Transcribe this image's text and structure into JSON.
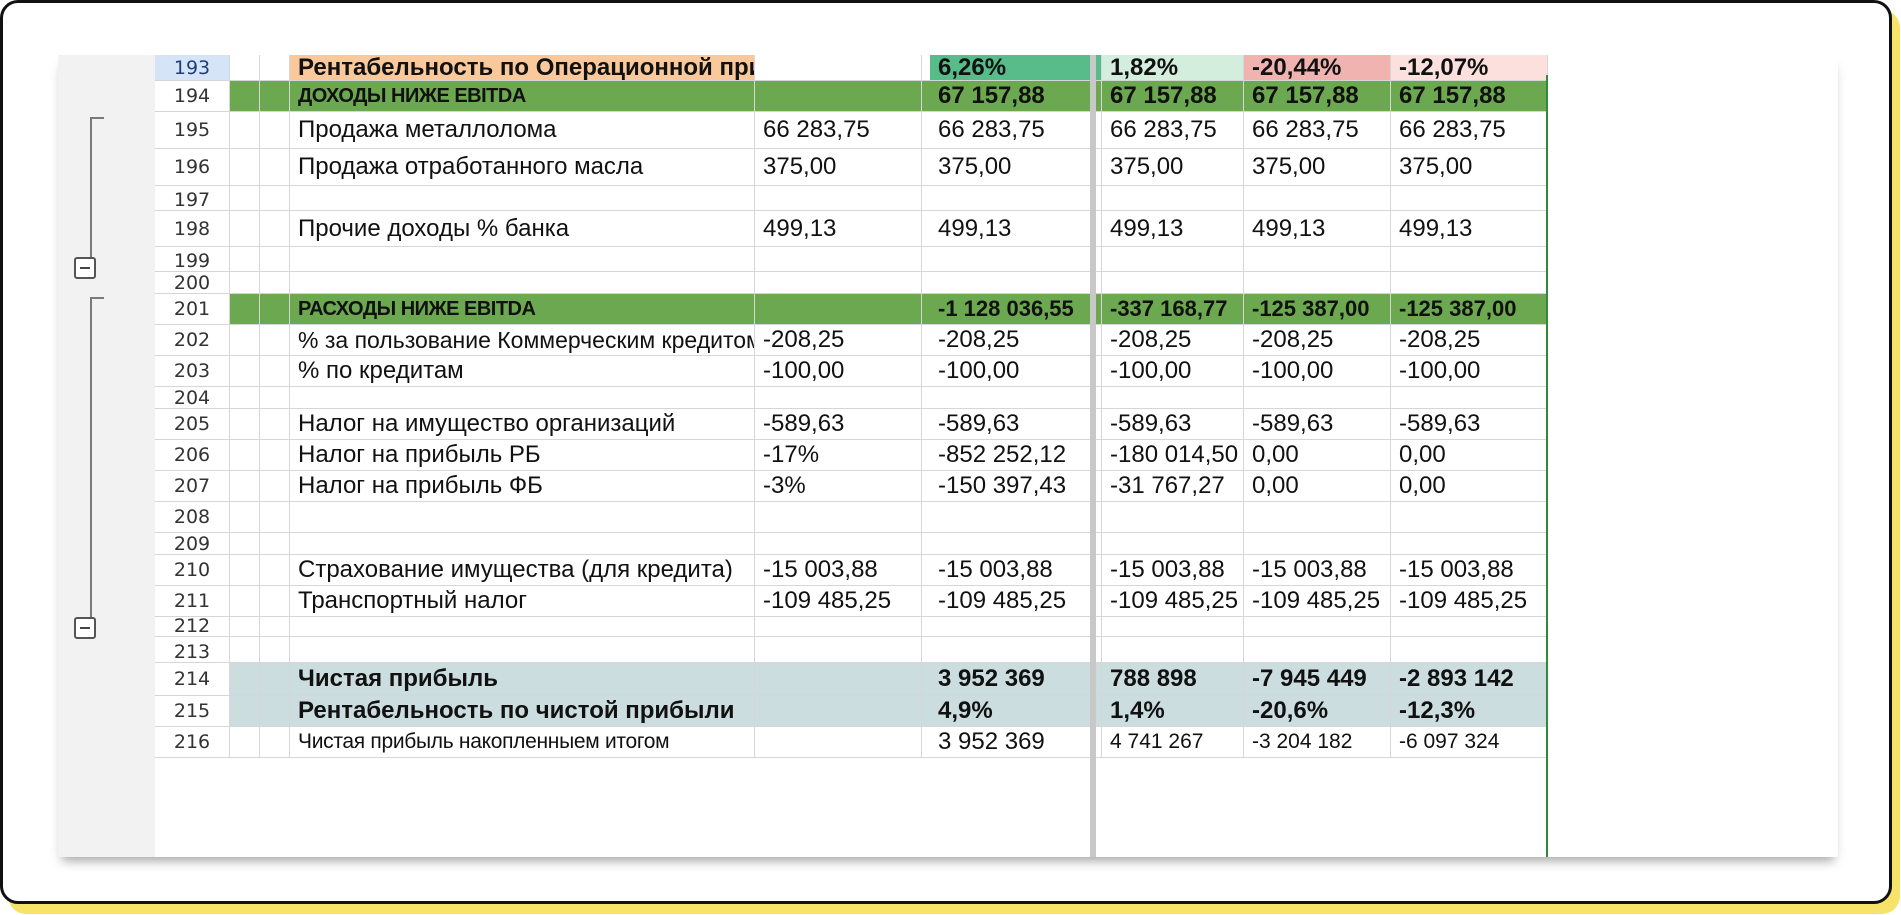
{
  "rows": [
    {
      "num": "193",
      "label": "Рентабельность по Операционной прибыли",
      "base": "",
      "v": [
        "6,26%",
        "1,82%",
        "-20,44%",
        "-12,07%"
      ]
    },
    {
      "num": "194",
      "label": "ДОХОДЫ НИЖЕ EBITDA",
      "base": "",
      "v": [
        "67 157,88",
        "67 157,88",
        "67 157,88",
        "67 157,88"
      ]
    },
    {
      "num": "195",
      "label": "Продажа металлолома",
      "base": "66 283,75",
      "v": [
        "66 283,75",
        "66 283,75",
        "66 283,75",
        "66 283,75"
      ]
    },
    {
      "num": "196",
      "label": "Продажа отработанного масла",
      "base": "375,00",
      "v": [
        "375,00",
        "375,00",
        "375,00",
        "375,00"
      ]
    },
    {
      "num": "197",
      "label": "",
      "base": "",
      "v": [
        "",
        "",
        "",
        ""
      ]
    },
    {
      "num": "198",
      "label": "Прочие доходы % банка",
      "base": "499,13",
      "v": [
        "499,13",
        "499,13",
        "499,13",
        "499,13"
      ]
    },
    {
      "num": "199",
      "label": "",
      "base": "",
      "v": [
        "",
        "",
        "",
        ""
      ]
    },
    {
      "num": "200",
      "label": "",
      "base": "",
      "v": [
        "",
        "",
        "",
        ""
      ]
    },
    {
      "num": "201",
      "label": "РАСХОДЫ НИЖЕ EBITDA",
      "base": "",
      "v": [
        "-1 128 036,55",
        "-337 168,77",
        "-125 387,00",
        "-125 387,00"
      ]
    },
    {
      "num": "202",
      "label": "% за пользование Коммерческим кредитом",
      "base": "-208,25",
      "v": [
        "-208,25",
        "-208,25",
        "-208,25",
        "-208,25"
      ]
    },
    {
      "num": "203",
      "label": "% по кредитам",
      "base": "-100,00",
      "v": [
        "-100,00",
        "-100,00",
        "-100,00",
        "-100,00"
      ]
    },
    {
      "num": "204",
      "label": "",
      "base": "",
      "v": [
        "",
        "",
        "",
        ""
      ]
    },
    {
      "num": "205",
      "label": "Налог на имущество организаций",
      "base": "-589,63",
      "v": [
        "-589,63",
        "-589,63",
        "-589,63",
        "-589,63"
      ]
    },
    {
      "num": "206",
      "label": "Налог на прибыль РБ",
      "base": "-17%",
      "v": [
        "-852 252,12",
        "-180 014,50",
        "0,00",
        "0,00"
      ]
    },
    {
      "num": "207",
      "label": "Налог на прибыль ФБ",
      "base": "-3%",
      "v": [
        "-150 397,43",
        "-31 767,27",
        "0,00",
        "0,00"
      ]
    },
    {
      "num": "208",
      "label": "",
      "base": "",
      "v": [
        "",
        "",
        "",
        ""
      ]
    },
    {
      "num": "209",
      "label": "",
      "base": "",
      "v": [
        "",
        "",
        "",
        ""
      ]
    },
    {
      "num": "210",
      "label": "Страхование имущества (для кредита)",
      "base": "-15 003,88",
      "v": [
        "-15 003,88",
        "-15 003,88",
        "-15 003,88",
        "-15 003,88"
      ]
    },
    {
      "num": "211",
      "label": "Транспортный налог",
      "base": "-109 485,25",
      "v": [
        "-109 485,25",
        "-109 485,25",
        "-109 485,25",
        "-109 485,25"
      ]
    },
    {
      "num": "212",
      "label": "",
      "base": "",
      "v": [
        "",
        "",
        "",
        ""
      ]
    },
    {
      "num": "213",
      "label": "",
      "base": "",
      "v": [
        "",
        "",
        "",
        ""
      ]
    },
    {
      "num": "214",
      "label": "Чистая прибыль",
      "base": "",
      "v": [
        "3 952 369",
        "788 898",
        "-7 945 449",
        "-2 893 142"
      ]
    },
    {
      "num": "215",
      "label": "Рентабельность по чистой прибыли",
      "base": "",
      "v": [
        "4,9%",
        "1,4%",
        "-20,6%",
        "-12,3%"
      ]
    },
    {
      "num": "216",
      "label": "Чистая прибыль накопленныем итогом",
      "base": "",
      "v": [
        "3 952 369",
        "4 741 267",
        "-3 204 182",
        "-6 097 324"
      ]
    }
  ],
  "colors": {
    "header_row_label_bg": "#f9c99b",
    "pct_cells_bg": [
      "#57bb8a",
      "#d3eedd",
      "#f0b3b0",
      "#fce0dd"
    ],
    "section_green": "#6ca84f",
    "net_profit_bg": "#ccdde0",
    "selected_row_number_bg": "#d5e4f7"
  }
}
